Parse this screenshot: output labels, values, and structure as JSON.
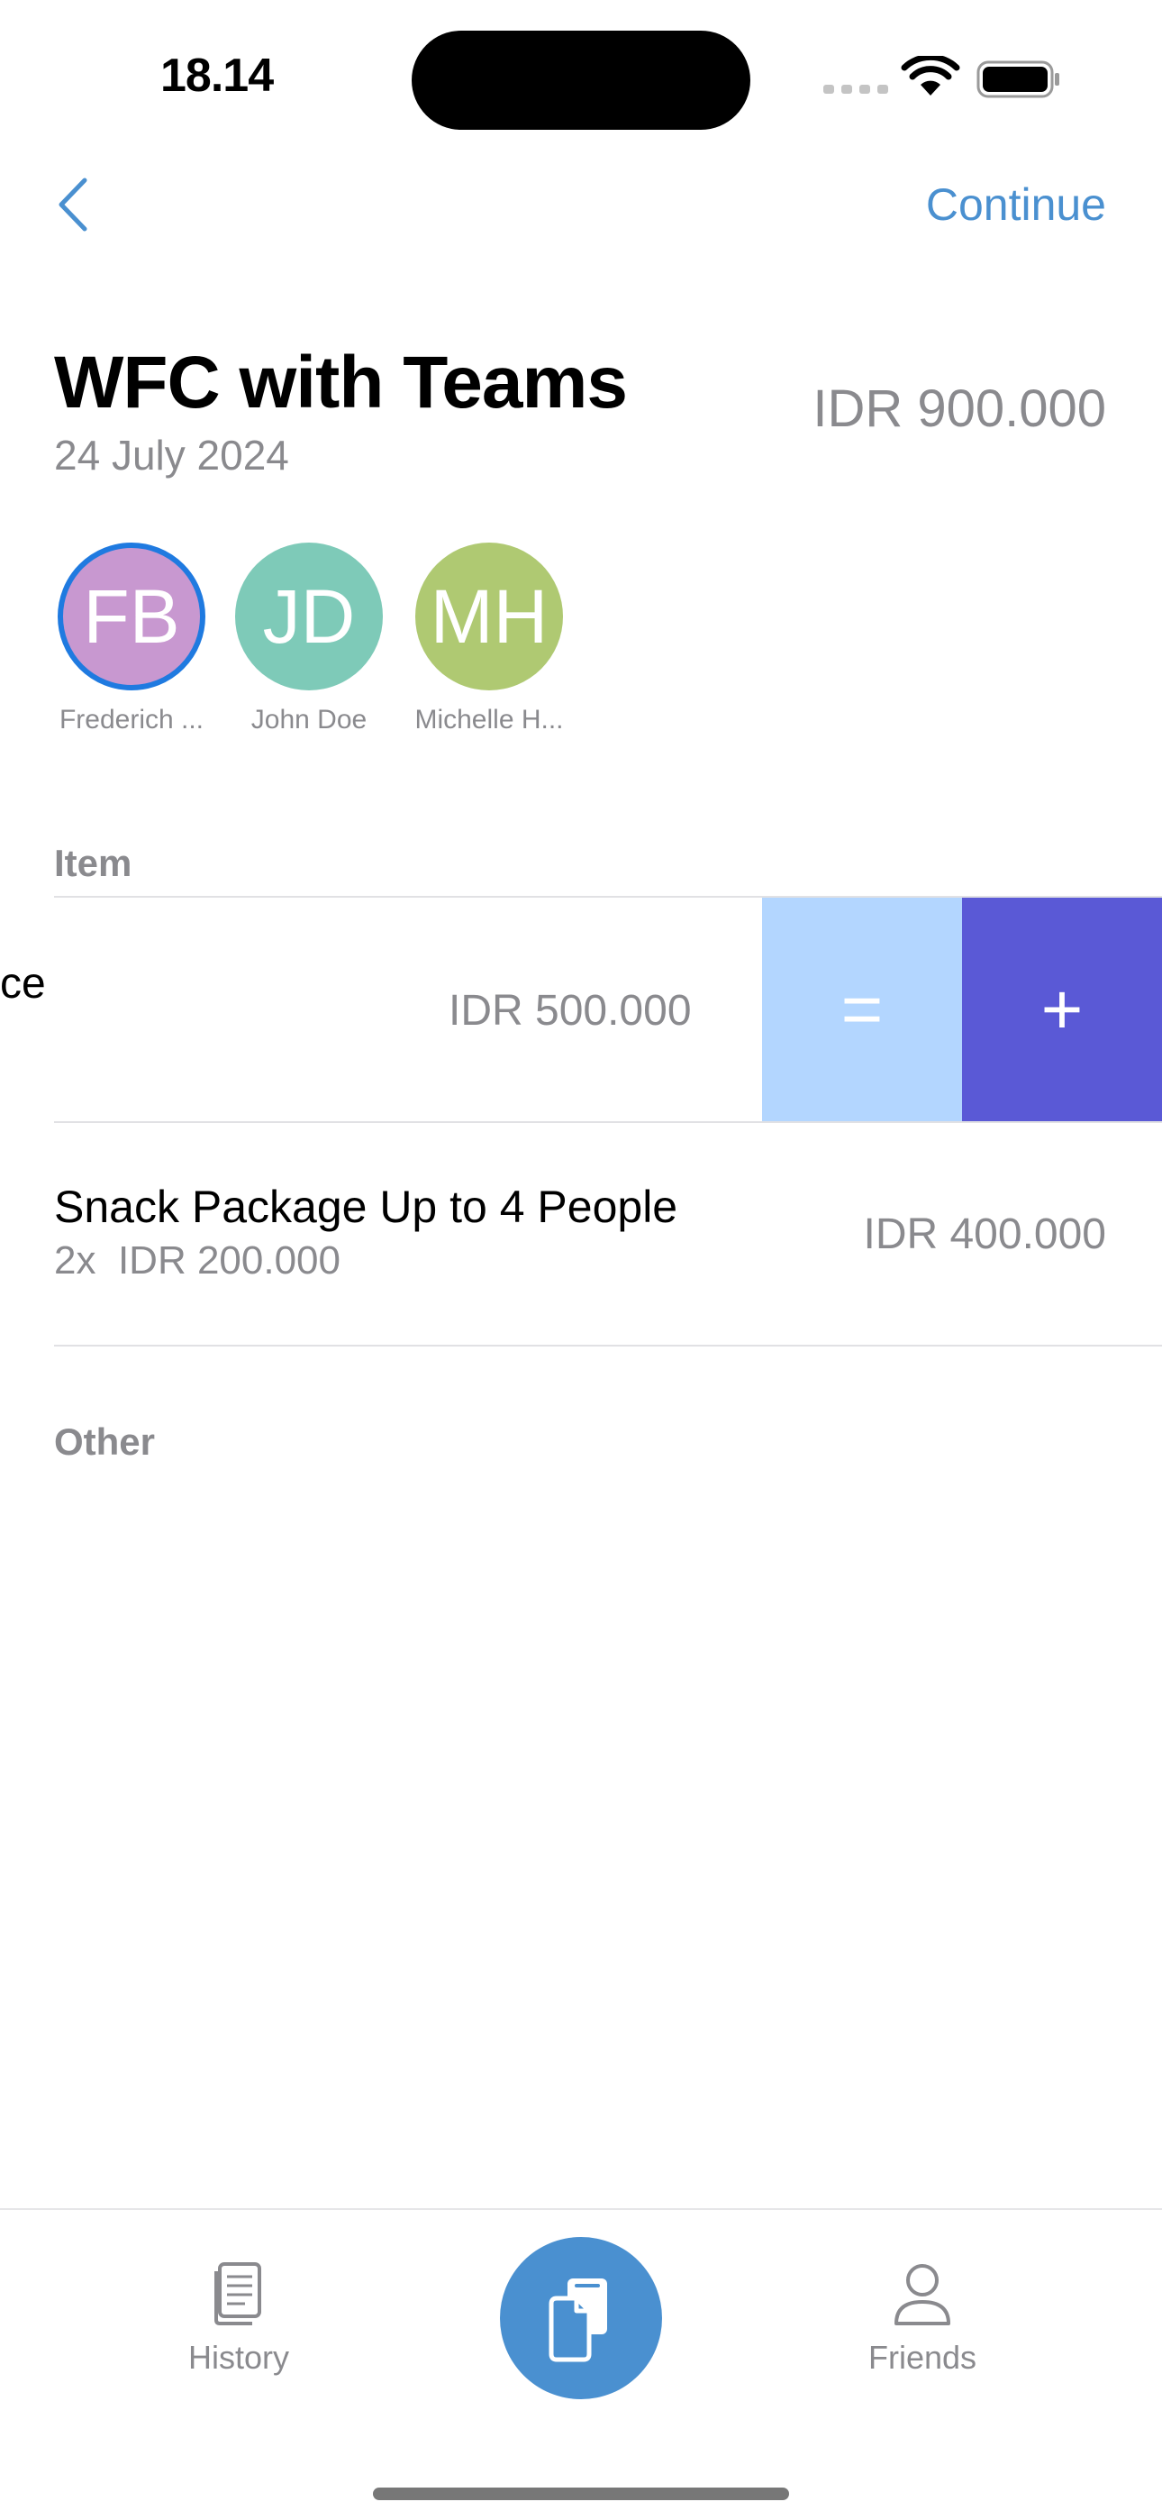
{
  "status_bar": {
    "time": "18.14"
  },
  "nav": {
    "continue_label": "Continue"
  },
  "header": {
    "title": "WFC with Teams",
    "date": "24 July 2024",
    "total": "IDR 900.000"
  },
  "participants": [
    {
      "initials": "FB",
      "name": "Frederich ...",
      "color": "#c898d0",
      "selected": true
    },
    {
      "initials": "JD",
      "name": "John Doe",
      "color": "#7ecab8",
      "selected": false
    },
    {
      "initials": "MH",
      "name": "Michelle H...",
      "color": "#afc972",
      "selected": false
    }
  ],
  "sections": {
    "item_label": "Item",
    "other_label": "Other"
  },
  "items": [
    {
      "name_visible": "ce",
      "price": "IDR 500.000"
    },
    {
      "name": "Snack Package Up to 4 People",
      "qty": "2x",
      "unit_price": "IDR 200.000",
      "price": "IDR 400.000"
    }
  ],
  "swipe_actions": {
    "equal": "=",
    "add": "+"
  },
  "tabbar": {
    "history_label": "History",
    "friends_label": "Friends"
  }
}
